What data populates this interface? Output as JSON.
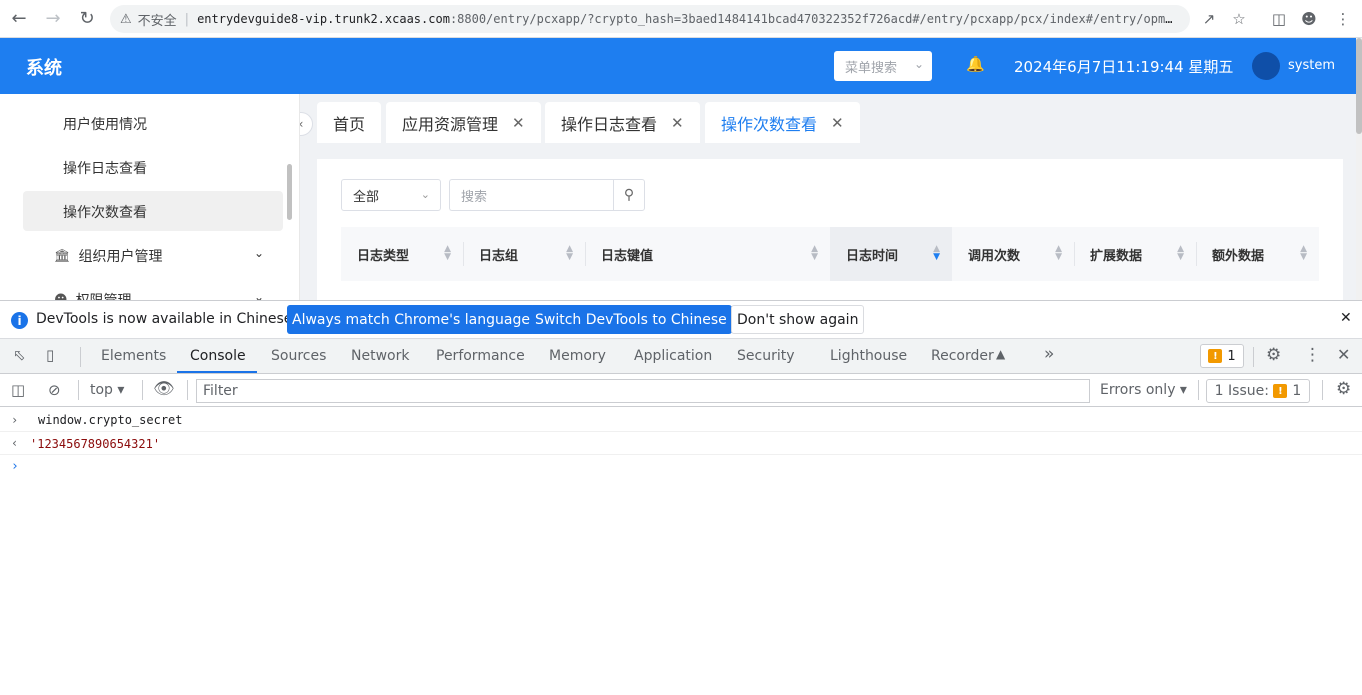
{
  "browser": {
    "insecure_label": "不安全",
    "url_host": "entrydevguide8-vip.trunk2.xcaas.com",
    "url_rest": ":8800/entry/pcxapp/?crypto_hash=3baed1484141bcad470322352f726acd#/entry/pcxapp/pcx/index#/entry/opm-mob…"
  },
  "header": {
    "title": "系统",
    "menu_search_placeholder": "菜单搜索",
    "datetime": "2024年6月7日11:19:44 星期五",
    "username": "system"
  },
  "sidebar": {
    "items": [
      {
        "label": "用户使用情况"
      },
      {
        "label": "操作日志查看"
      },
      {
        "label": "操作次数查看",
        "active": true
      }
    ],
    "groups": [
      {
        "label": "组织用户管理",
        "icon": "bank-icon"
      },
      {
        "label": "权限管理",
        "icon": "user-group-icon"
      }
    ]
  },
  "tabs": [
    {
      "label": "首页",
      "closable": false
    },
    {
      "label": "应用资源管理",
      "closable": true
    },
    {
      "label": "操作日志查看",
      "closable": true
    },
    {
      "label": "操作次数查看",
      "closable": true,
      "active": true
    }
  ],
  "filters": {
    "type_value": "全部",
    "search_placeholder": "搜索"
  },
  "table": {
    "columns": [
      {
        "label": "日志类型"
      },
      {
        "label": "日志组"
      },
      {
        "label": "日志键值"
      },
      {
        "label": "日志时间",
        "sorted": "desc"
      },
      {
        "label": "调用次数"
      },
      {
        "label": "扩展数据"
      },
      {
        "label": "额外数据"
      }
    ]
  },
  "devtools": {
    "infobar": {
      "message": "DevTools is now available in Chinese!",
      "btn_match": "Always match Chrome's language",
      "btn_switch": "Switch DevTools to Chinese",
      "btn_dismiss": "Don't show again"
    },
    "tabs": [
      "Elements",
      "Console",
      "Sources",
      "Network",
      "Performance",
      "Memory",
      "Application",
      "Security",
      "Lighthouse",
      "Recorder"
    ],
    "active_tab": "Console",
    "issue_count": "1",
    "toolbar": {
      "context": "top",
      "filter_placeholder": "Filter",
      "levels": "Errors only",
      "issues_label": "1 Issue:",
      "issues_count": "1"
    },
    "console": {
      "input": "window.crypto_secret",
      "output": "'1234567890654321'"
    },
    "colors": {
      "accent": "#1a73e8",
      "app_header": "#1e7ef0",
      "string": "#8b0b0b"
    }
  }
}
